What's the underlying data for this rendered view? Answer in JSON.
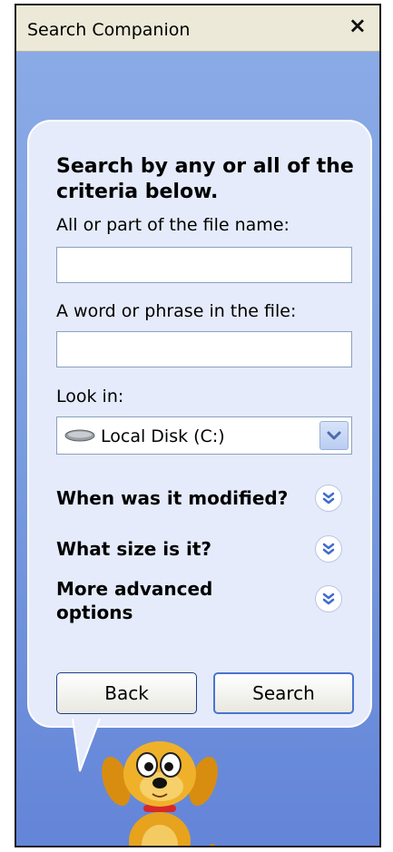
{
  "window": {
    "title": "Search Companion",
    "close_glyph": "×"
  },
  "form": {
    "heading": "Search by any or all of the criteria below.",
    "filename_label": "All or part of the file name:",
    "filename_value": "",
    "phrase_label": "A word or phrase in the file:",
    "phrase_value": "",
    "lookin_label": "Look in:",
    "lookin_value": "Local Disk (C:)"
  },
  "options": [
    {
      "label": "When was it modified?",
      "icon": "expand-chevron-icon"
    },
    {
      "label": "What size is it?",
      "icon": "expand-chevron-icon"
    },
    {
      "label": "More advanced options",
      "icon": "expand-chevron-icon"
    }
  ],
  "buttons": {
    "back": "Back",
    "search": "Search"
  },
  "colors": {
    "panel": "#6f93dd",
    "bubble": "#e5ebfa",
    "titlebar": "#ece9d8",
    "button_border": "#1d3f8a"
  }
}
